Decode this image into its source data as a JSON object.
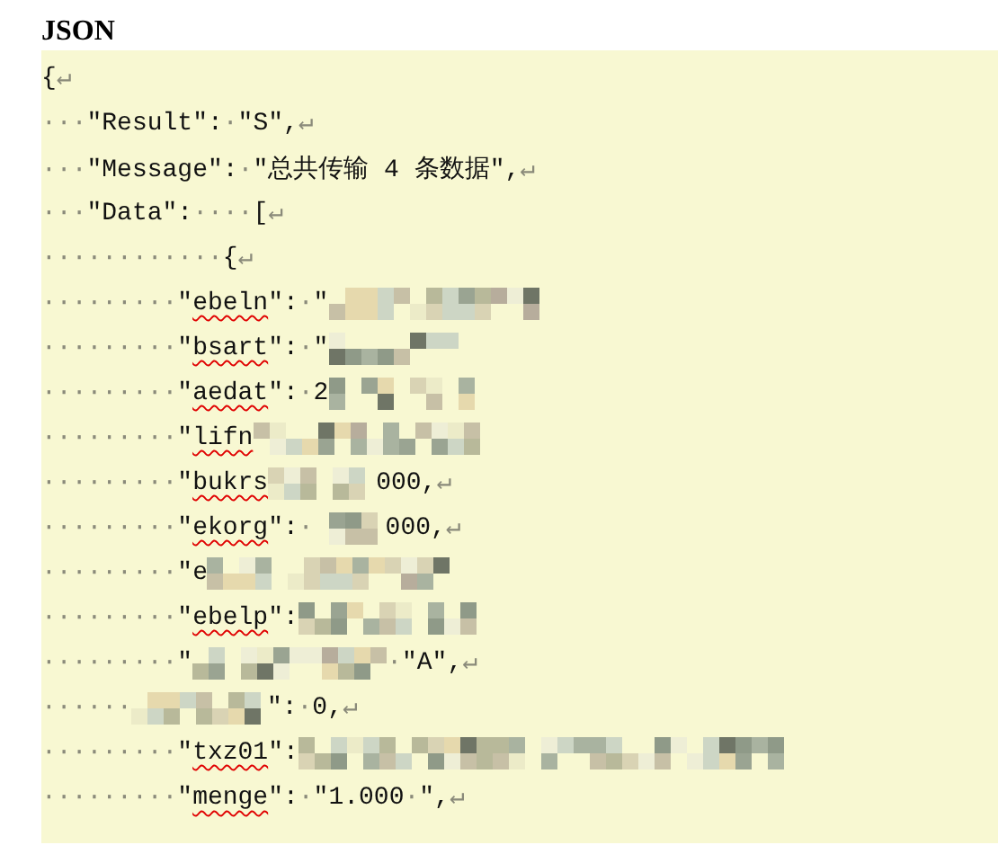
{
  "heading": "JSON",
  "code_lines": [
    {
      "segments": [
        {
          "kind": "text",
          "text": "{↵"
        }
      ]
    },
    {
      "segments": [
        {
          "kind": "text",
          "text": "···\"Result\":·\"S\",↵"
        }
      ]
    },
    {
      "segments": [
        {
          "kind": "text",
          "text": "···\"Message\":·\"总共传输 4 条数据\",↵"
        }
      ]
    },
    {
      "segments": [
        {
          "kind": "text",
          "text": "···\"Data\":····[↵"
        }
      ]
    },
    {
      "segments": [
        {
          "kind": "text",
          "text": "············{↵"
        }
      ]
    },
    {
      "segments": [
        {
          "kind": "text",
          "text": "·········\""
        },
        {
          "kind": "misspelled",
          "text": "ebeln"
        },
        {
          "kind": "text",
          "text": "\":·\""
        },
        {
          "kind": "redaction"
        }
      ]
    },
    {
      "segments": [
        {
          "kind": "text",
          "text": "·········\""
        },
        {
          "kind": "misspelled",
          "text": "bsart"
        },
        {
          "kind": "text",
          "text": "\":·\""
        },
        {
          "kind": "redaction"
        }
      ]
    },
    {
      "segments": [
        {
          "kind": "text",
          "text": "·········\""
        },
        {
          "kind": "misspelled",
          "text": "aedat"
        },
        {
          "kind": "text",
          "text": "\":·2"
        },
        {
          "kind": "redaction"
        }
      ]
    },
    {
      "segments": [
        {
          "kind": "text",
          "text": "·········\""
        },
        {
          "kind": "misspelled",
          "text": "lifn"
        },
        {
          "kind": "redaction"
        }
      ]
    },
    {
      "segments": [
        {
          "kind": "text",
          "text": "·········\""
        },
        {
          "kind": "misspelled",
          "text": "bukrs"
        },
        {
          "kind": "redaction"
        },
        {
          "kind": "text",
          "text": "000,↵"
        }
      ]
    },
    {
      "segments": [
        {
          "kind": "text",
          "text": "·········\""
        },
        {
          "kind": "misspelled",
          "text": "ekorg"
        },
        {
          "kind": "text",
          "text": "\":·"
        },
        {
          "kind": "redaction"
        },
        {
          "kind": "text",
          "text": "000,↵"
        }
      ]
    },
    {
      "segments": [
        {
          "kind": "text",
          "text": "·········\"e"
        },
        {
          "kind": "redaction"
        }
      ]
    },
    {
      "segments": [
        {
          "kind": "text",
          "text": "·········\""
        },
        {
          "kind": "misspelled",
          "text": "ebelp"
        },
        {
          "kind": "text",
          "text": "\":"
        },
        {
          "kind": "redaction"
        }
      ]
    },
    {
      "segments": [
        {
          "kind": "text",
          "text": "·········\""
        },
        {
          "kind": "redaction"
        },
        {
          "kind": "text",
          "text": "·\"A\",↵"
        }
      ]
    },
    {
      "segments": [
        {
          "kind": "text",
          "text": "······"
        },
        {
          "kind": "redaction"
        },
        {
          "kind": "text",
          "text": "\":·0,↵"
        }
      ]
    },
    {
      "segments": [
        {
          "kind": "text",
          "text": "·········\""
        },
        {
          "kind": "misspelled",
          "text": "txz01"
        },
        {
          "kind": "text",
          "text": "\":"
        },
        {
          "kind": "redaction"
        }
      ]
    },
    {
      "segments": [
        {
          "kind": "text",
          "text": "·········\""
        },
        {
          "kind": "misspelled",
          "text": "menge"
        },
        {
          "kind": "text",
          "text": "\":·\"1.000·\",↵"
        }
      ]
    }
  ]
}
